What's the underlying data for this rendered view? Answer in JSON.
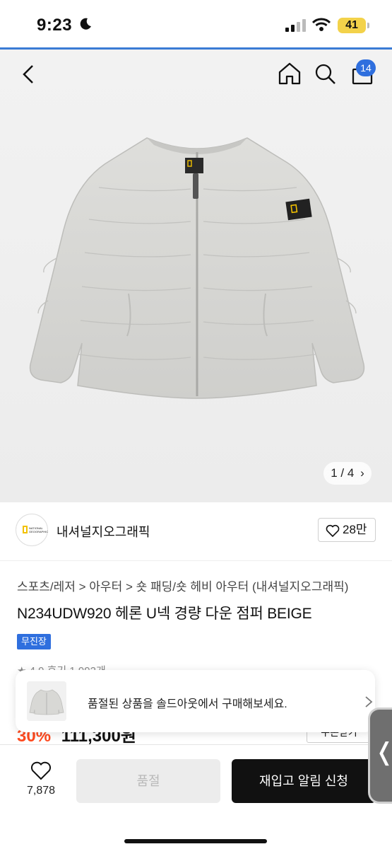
{
  "status": {
    "time": "9:23",
    "battery": "41"
  },
  "header": {
    "cart_count": "14"
  },
  "gallery": {
    "pager": "1 / 4"
  },
  "brand": {
    "logo_text": "NATIONAL GEOGRAPHIC",
    "name": "내셔널지오그래픽",
    "likes": "28만"
  },
  "product": {
    "breadcrumb": "스포츠/레저 > 아우터 > 숏 패딩/숏 헤비 아우터 (내셔널지오그래픽)",
    "title": "N234UDW920 헤론 U넥 경량 다운 점퍼 BEIGE",
    "tag": "무진장",
    "rating_partial": "★ 4.9  후기 1,992개",
    "discount_partial": "30%",
    "price_partial": "111,300원",
    "coupon_partial": "쿠폰받기"
  },
  "toast": {
    "message": "품절된 상품을 솔드아웃에서 구매해보세요."
  },
  "bottom": {
    "wish_count": "7,878",
    "soldout_label": "품절",
    "restock_label": "재입고 알림 신청"
  },
  "icons": [
    "back-arrow-icon",
    "home-icon",
    "search-icon",
    "shopping-bag-icon",
    "heart-icon",
    "chevron-right-icon",
    "chevron-left-icon",
    "moon-icon",
    "signal-icon",
    "wifi-icon"
  ],
  "colors": {
    "accent": "#2f6fde",
    "discount": "#ff4a1f",
    "battery": "#f3d24a"
  }
}
